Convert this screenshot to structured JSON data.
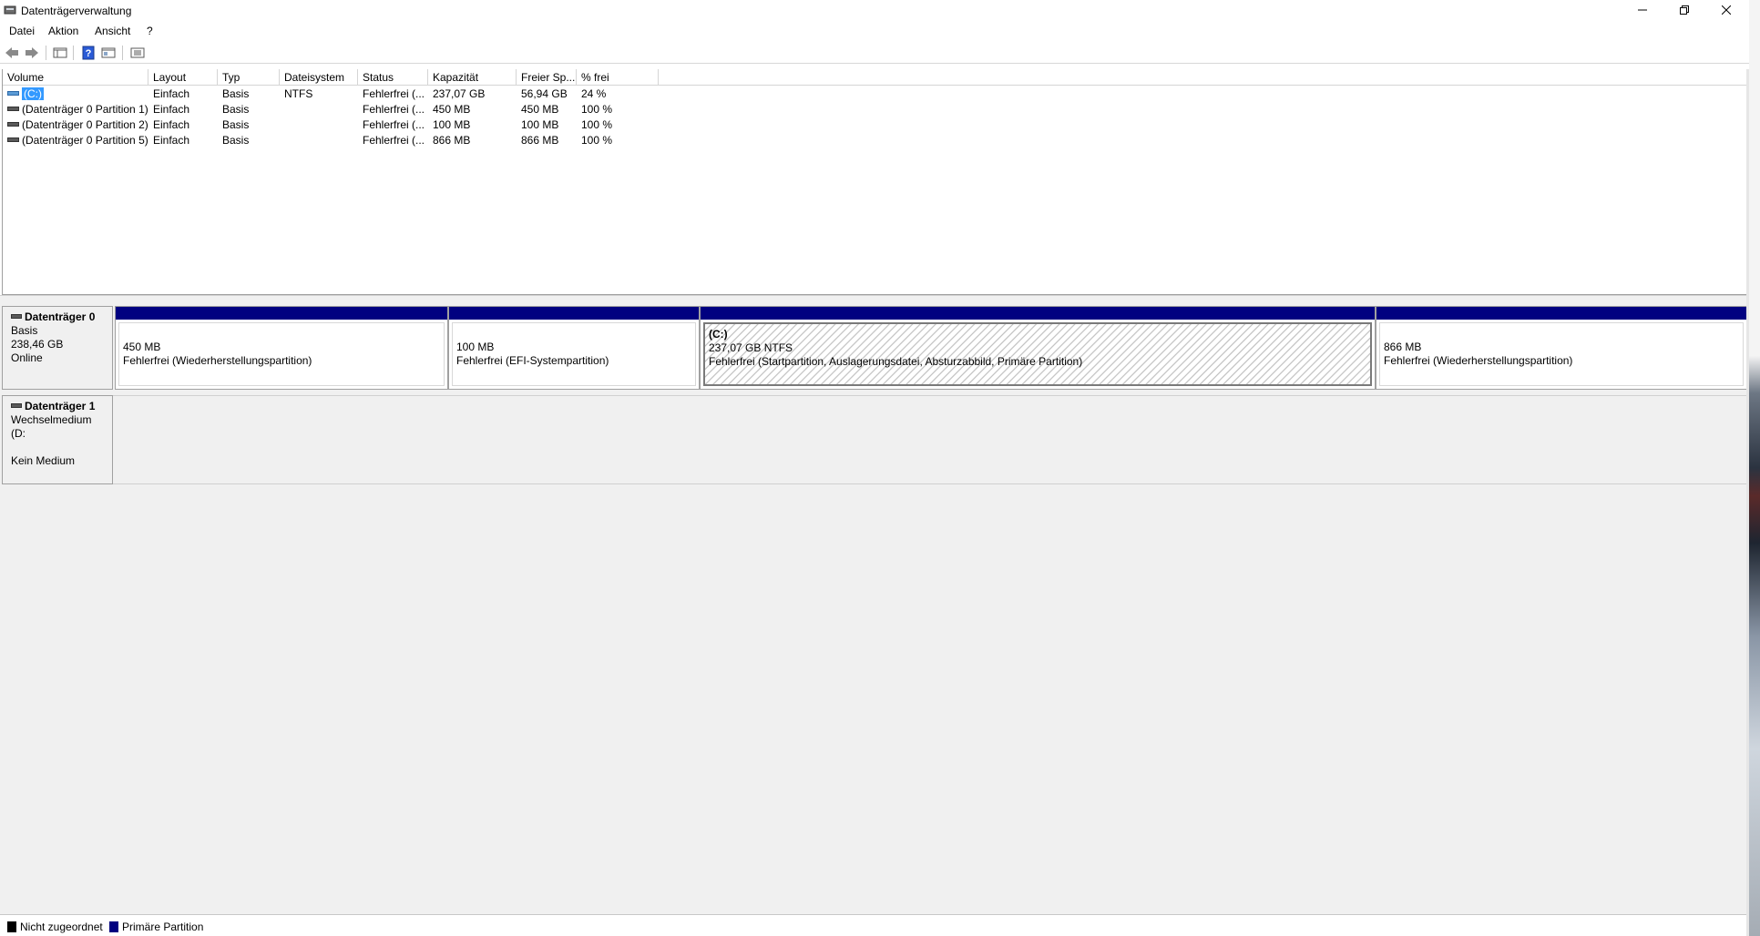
{
  "window": {
    "title": "Datenträgerverwaltung",
    "app_icon": "disk-management-icon"
  },
  "menu": {
    "items": [
      "Datei",
      "Aktion",
      "Ansicht",
      "?"
    ]
  },
  "toolbar": {
    "buttons": [
      "back-arrow-icon",
      "forward-arrow-icon",
      "console-tree-icon",
      "help-icon",
      "properties-icon",
      "view-icon"
    ]
  },
  "volume_list": {
    "columns": [
      "Volume",
      "Layout",
      "Typ",
      "Dateisystem",
      "Status",
      "Kapazität",
      "Freier Sp...",
      "% frei"
    ],
    "rows": [
      {
        "volume": "(C:)",
        "layout": "Einfach",
        "typ": "Basis",
        "dateisystem": "NTFS",
        "status": "Fehlerfrei (...",
        "kapazitaet": "237,07 GB",
        "frei": "56,94 GB",
        "prozent": "24 %"
      },
      {
        "volume": "(Datenträger 0 Partition 1)",
        "layout": "Einfach",
        "typ": "Basis",
        "dateisystem": "",
        "status": "Fehlerfrei (...",
        "kapazitaet": "450 MB",
        "frei": "450 MB",
        "prozent": "100 %"
      },
      {
        "volume": "(Datenträger 0 Partition 2)",
        "layout": "Einfach",
        "typ": "Basis",
        "dateisystem": "",
        "status": "Fehlerfrei (...",
        "kapazitaet": "100 MB",
        "frei": "100 MB",
        "prozent": "100 %"
      },
      {
        "volume": "(Datenträger 0 Partition 5)",
        "layout": "Einfach",
        "typ": "Basis",
        "dateisystem": "",
        "status": "Fehlerfrei (...",
        "kapazitaet": "866 MB",
        "frei": "866 MB",
        "prozent": "100 %"
      }
    ]
  },
  "disks": [
    {
      "name": "Datenträger 0",
      "type": "Basis",
      "size": "238,46 GB",
      "state": "Online",
      "partitions": [
        {
          "title": "",
          "size": "450 MB",
          "status": "Fehlerfrei (Wiederherstellungspartition)"
        },
        {
          "title": "",
          "size": "100 MB",
          "status": "Fehlerfrei (EFI-Systempartition)"
        },
        {
          "title": "(C:)",
          "size": "237,07 GB NTFS",
          "status": "Fehlerfrei (Startpartition, Auslagerungsdatei, Absturzabbild, Primäre Partition)"
        },
        {
          "title": "",
          "size": "866 MB",
          "status": "Fehlerfrei (Wiederherstellungspartition)"
        }
      ]
    },
    {
      "name": "Datenträger 1",
      "type": "Wechselmedium (D:",
      "size": "",
      "state": "Kein Medium"
    }
  ],
  "legend": [
    {
      "label": "Nicht zugeordnet",
      "color": "#000000"
    },
    {
      "label": "Primäre Partition",
      "color": "#000080"
    }
  ]
}
